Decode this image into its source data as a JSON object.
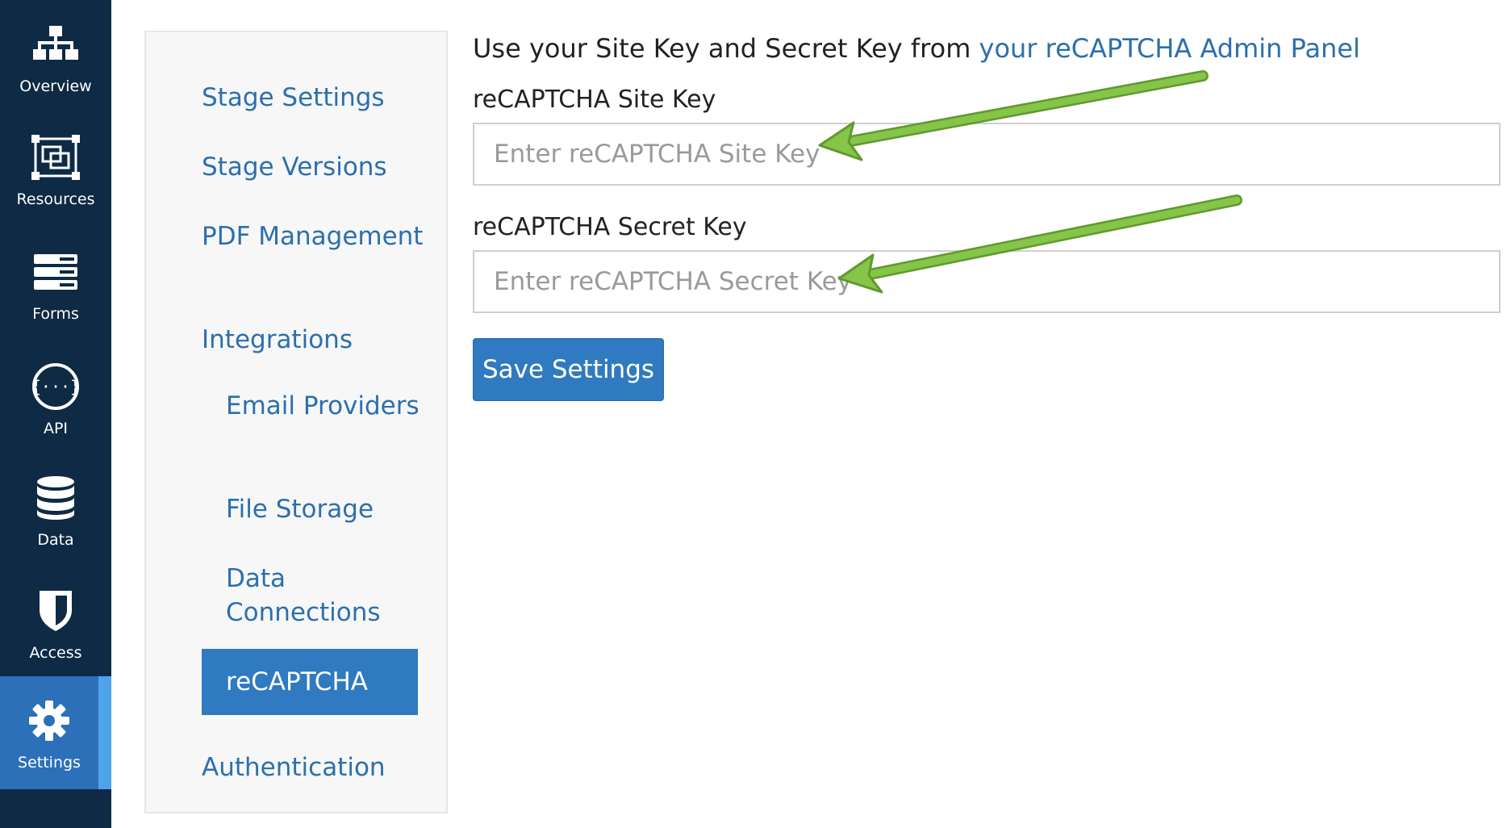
{
  "rail": {
    "items": [
      {
        "label": "Overview",
        "icon": "sitemap-icon"
      },
      {
        "label": "Resources",
        "icon": "resources-icon"
      },
      {
        "label": "Forms",
        "icon": "forms-icon"
      },
      {
        "label": "API",
        "icon": "api-icon"
      },
      {
        "label": "Data",
        "icon": "database-icon"
      },
      {
        "label": "Access",
        "icon": "shield-icon"
      },
      {
        "label": "Settings",
        "icon": "gear-icon",
        "active": true
      }
    ]
  },
  "subnav": {
    "items": [
      {
        "label": "Stage Settings"
      },
      {
        "label": "Stage Versions"
      },
      {
        "label": "PDF Management"
      },
      {
        "label": "Integrations"
      },
      {
        "label": "Email Providers"
      },
      {
        "label": "File Storage"
      },
      {
        "label": "Data Connections"
      },
      {
        "label": "reCAPTCHA",
        "active": true
      },
      {
        "label": "Authentication"
      }
    ]
  },
  "main": {
    "intro_text": "Use your Site Key and Secret Key from ",
    "intro_link": "your reCAPTCHA Admin Panel",
    "site_key": {
      "label": "reCAPTCHA Site Key",
      "placeholder": "Enter reCAPTCHA Site Key",
      "value": ""
    },
    "secret_key": {
      "label": "reCAPTCHA Secret Key",
      "placeholder": "Enter reCAPTCHA Secret Key",
      "value": ""
    },
    "save_label": "Save Settings"
  },
  "colors": {
    "rail_bg": "#0e2a44",
    "accent": "#2f7ac0",
    "link": "#2c6fad",
    "annotation_arrow": "#86c44a"
  }
}
